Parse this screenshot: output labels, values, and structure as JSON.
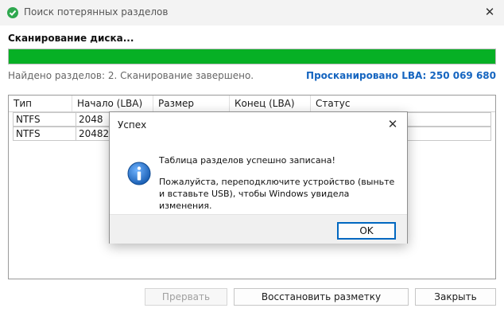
{
  "window": {
    "title": "Поиск потерянных разделов",
    "close_glyph": "✕"
  },
  "scan": {
    "title": "Сканирование диска...",
    "progress_fraction": 1.0,
    "status": "Найдено разделов: 2. Сканирование завершено.",
    "lba_label": "Просканировано LBA: 250 069 680"
  },
  "table": {
    "headers": [
      "Тип",
      "Начало (LBA)",
      "Размер",
      "Конец (LBA)",
      "Статус"
    ],
    "rows": [
      [
        "NTFS",
        "2048",
        "",
        "",
        ""
      ],
      [
        "NTFS",
        "204820",
        "",
        "",
        ""
      ]
    ]
  },
  "buttons": {
    "abort": "Прервать",
    "restore": "Восстановить разметку",
    "close": "Закрыть"
  },
  "dialog": {
    "title": "Успех",
    "close_glyph": "✕",
    "line1": "Таблица разделов успешно записана!",
    "line2": "Пожалуйста, переподключите устройство (выньте и вставьте USB), чтобы Windows увидела изменения.",
    "ok": "OK",
    "icon": "info-icon"
  },
  "colors": {
    "progress": "#06b025",
    "link": "#1565c0",
    "info": "#1a5fb4",
    "focus": "#0067c0"
  }
}
